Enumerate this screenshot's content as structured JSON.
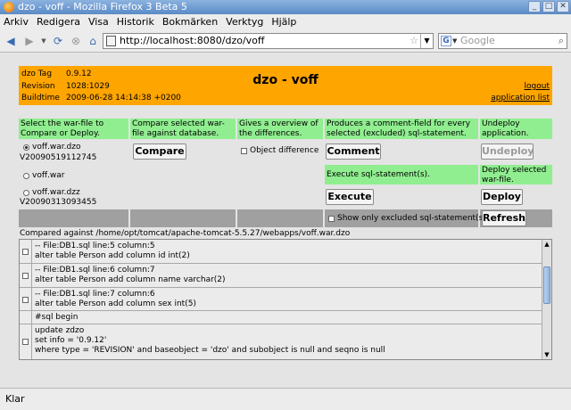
{
  "window": {
    "title": "dzo - voff - Mozilla Firefox 3 Beta 5"
  },
  "menu": [
    "Arkiv",
    "Redigera",
    "Visa",
    "Historik",
    "Bokmärken",
    "Verktyg",
    "Hjälp"
  ],
  "nav": {
    "url": "http://localhost:8080/dzo/voff",
    "search_placeholder": "Google"
  },
  "header": {
    "tag_label": "dzo Tag",
    "tag_value": "0.9.12",
    "revision_label": "Revision",
    "revision_value": "1028:1029",
    "buildtime_label": "Buildtime",
    "buildtime_value": "2009-06-28 14:14:38 +0200",
    "title": "dzo - voff",
    "logout": "logout",
    "app_list": "application list"
  },
  "descriptions": {
    "select": "Select the war-file to Compare or Deploy.",
    "compare": "Compare selected war-file against database.",
    "overview": "Gives a overview of the differences.",
    "comment": "Produces a comment-field for every selected (excluded) sql-statement.",
    "undeploy": "Undeploy application.",
    "execute": "Execute sql-statement(s).",
    "deploy": "Deploy selected war-file."
  },
  "war_files": [
    {
      "name": "voff.war.dzo",
      "version": "V20090519112745",
      "selected": true
    },
    {
      "name": "voff.war",
      "version": "",
      "selected": false
    },
    {
      "name": "voff.war.dzz",
      "version": "V20090313093455",
      "selected": false
    }
  ],
  "buttons": {
    "compare": "Compare",
    "comment": "Comment",
    "undeploy": "Undeploy",
    "execute": "Execute",
    "deploy": "Deploy",
    "refresh": "Refresh"
  },
  "checkboxes": {
    "object_difference": "Object difference",
    "show_excluded": "Show only excluded sql-statement(s)"
  },
  "compared_against": "Compared against /home/opt/tomcat/apache-tomcat-5.5.27/webapps/voff.war.dzo",
  "statements": [
    {
      "line1": "-- File:DB1.sql line:5 column:5",
      "line2": "alter table Person add column id int(2)"
    },
    {
      "line1": "-- File:DB1.sql line:6 column:7",
      "line2": "alter table Person add column name varchar(2)"
    },
    {
      "line1": "-- File:DB1.sql line:7 column:6",
      "line2": "alter table Person add column sex int(5)"
    },
    {
      "line1": "#sql begin"
    },
    {
      "line1": "update zdzo",
      "line2": "set info = '0.9.12'",
      "line3": "where type = 'REVISION' and baseobject = 'dzo' and subobject is null and seqno is null"
    }
  ],
  "status": "Klar",
  "colors": {
    "header": "#ffa500",
    "description": "#90ee90",
    "separator": "#a0a0a0"
  }
}
